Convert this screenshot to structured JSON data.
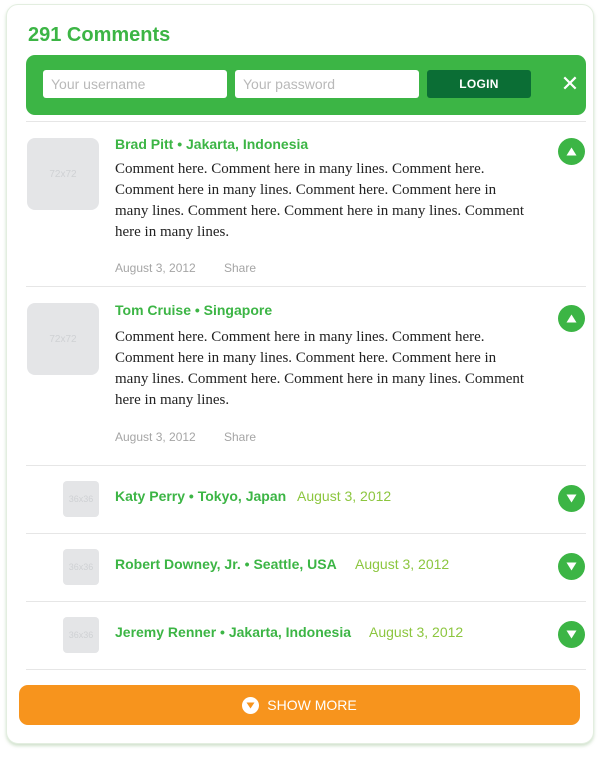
{
  "header": {
    "title": "291 Comments"
  },
  "login": {
    "username_placeholder": "Your username",
    "password_placeholder": "Your password",
    "login_label": "LOGIN",
    "close_icon": "close-icon",
    "close_glyph": "✕"
  },
  "comments": [
    {
      "author": "Brad Pitt • Jakarta, Indonesia",
      "avatar_label": "72x72",
      "body": "Comment here. Comment here in many lines. Comment here. Comment here in many lines. Comment here. Comment here in many lines. Comment here. Comment here in many lines. Comment here in many lines.",
      "date": "August 3, 2012",
      "share": "Share",
      "toggle_icon": "chevron-up-icon"
    },
    {
      "author": "Tom Cruise • Singapore",
      "avatar_label": "72x72",
      "body": "Comment here. Comment here in many lines. Comment here. Comment here in many lines. Comment here. Comment here in many lines. Comment here. Comment here in many lines. Comment here in many lines.",
      "date": "August 3, 2012",
      "share": "Share",
      "toggle_icon": "chevron-up-icon"
    }
  ],
  "collapsed": [
    {
      "author": "Katy Perry • Tokyo, Japan",
      "avatar_label": "36x36",
      "date": "August 3, 2012",
      "toggle_icon": "chevron-down-icon"
    },
    {
      "author": "Robert Downey, Jr. • Seattle, USA",
      "avatar_label": "36x36",
      "date": "August 3, 2012",
      "toggle_icon": "chevron-down-icon"
    },
    {
      "author": "Jeremy Renner • Jakarta, Indonesia",
      "avatar_label": "36x36",
      "date": "August 3, 2012",
      "toggle_icon": "chevron-down-icon"
    }
  ],
  "footer": {
    "show_more_label": "SHOW MORE",
    "show_more_icon": "chevron-down-icon"
  },
  "colors": {
    "accent_green": "#3cb545",
    "dark_green": "#0b6e35",
    "date_green": "#8cc63f",
    "orange": "#f7941d",
    "avatar_gray": "#e4e5e7"
  }
}
